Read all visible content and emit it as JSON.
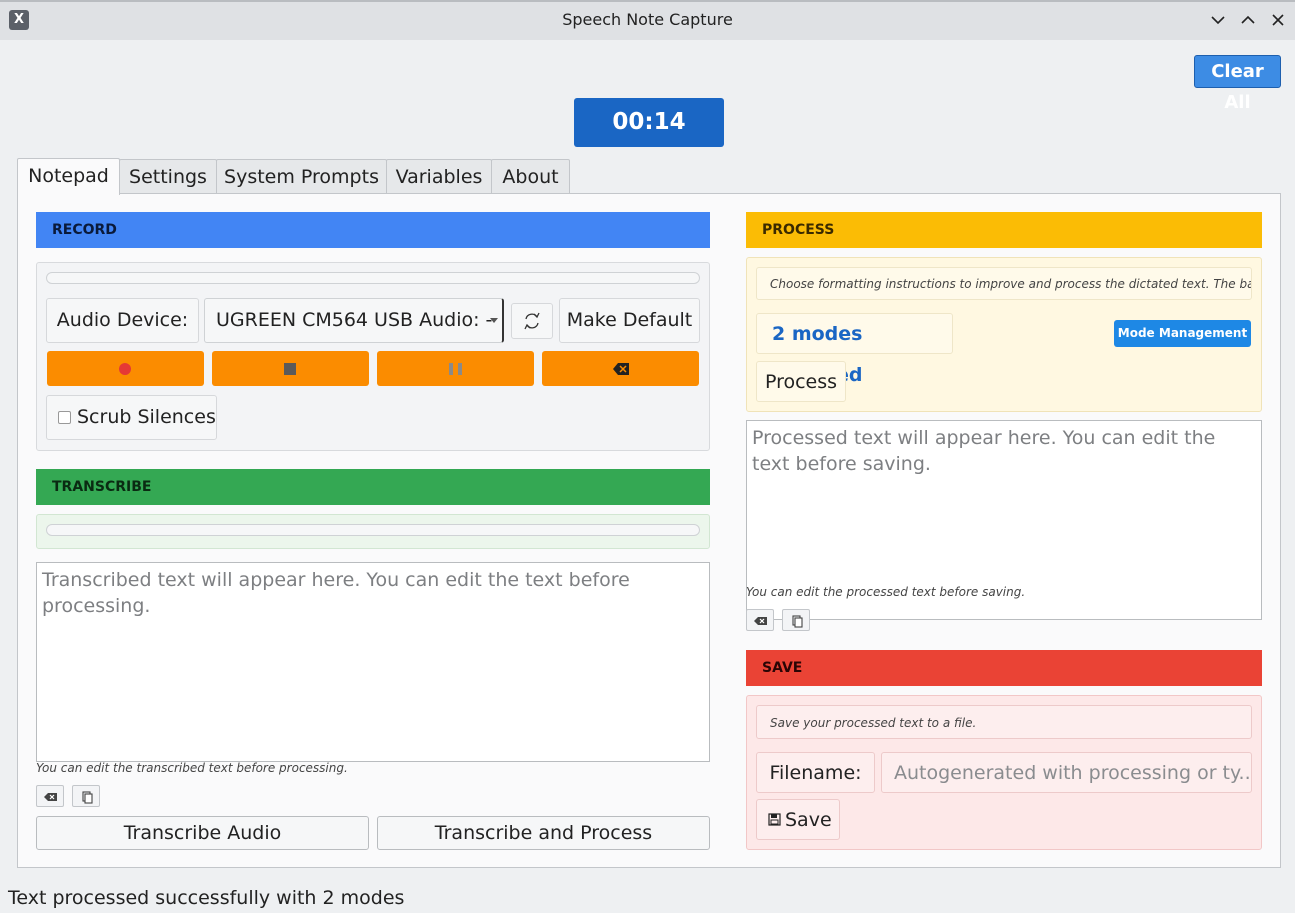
{
  "window": {
    "title": "Speech Note Capture",
    "app_icon_glyph": "X"
  },
  "toolbar": {
    "clear_all_label": "Clear All",
    "timer": "00:14"
  },
  "tabs": [
    {
      "label": "Notepad",
      "active": true
    },
    {
      "label": "Settings"
    },
    {
      "label": "System Prompts"
    },
    {
      "label": "Variables"
    },
    {
      "label": "About"
    }
  ],
  "record": {
    "header": "RECORD",
    "audio_device_label": "Audio Device:",
    "audio_device_value": "UGREEN CM564 USB Audio: -",
    "make_default_label": "Make Default",
    "scrub_silences_label": "Scrub Silences",
    "scrub_silences_checked": false
  },
  "transcribe": {
    "header": "TRANSCRIBE",
    "text_placeholder": "Transcribed text will appear here. You can edit the text before processing.",
    "hint": "You can edit the transcribed text before processing.",
    "transcribe_audio_label": "Transcribe Audio",
    "transcribe_and_process_label": "Transcribe and Process"
  },
  "process": {
    "header": "PROCESS",
    "description": "Choose formatting instructions to improve and process the dictated text. The basic",
    "modes_selected": "2 modes selected",
    "mode_management_label": "Mode Management",
    "process_label": "Process",
    "text_placeholder": "Processed text will appear here. You can edit the text before saving.",
    "hint": "You can edit the processed text before saving."
  },
  "save": {
    "header": "SAVE",
    "description": "Save your processed text to a file.",
    "filename_label": "Filename:",
    "filename_placeholder": "Autogenerated with processing or ty...",
    "save_label": "Save"
  },
  "status": {
    "message": "Text processed successfully with 2 modes"
  },
  "colors": {
    "record": "#4285f4",
    "transcribe": "#34a853",
    "process": "#fbbc05",
    "save": "#ea4335",
    "record_buttons": "#fb8c00",
    "timer_bg": "#1a66c4"
  }
}
